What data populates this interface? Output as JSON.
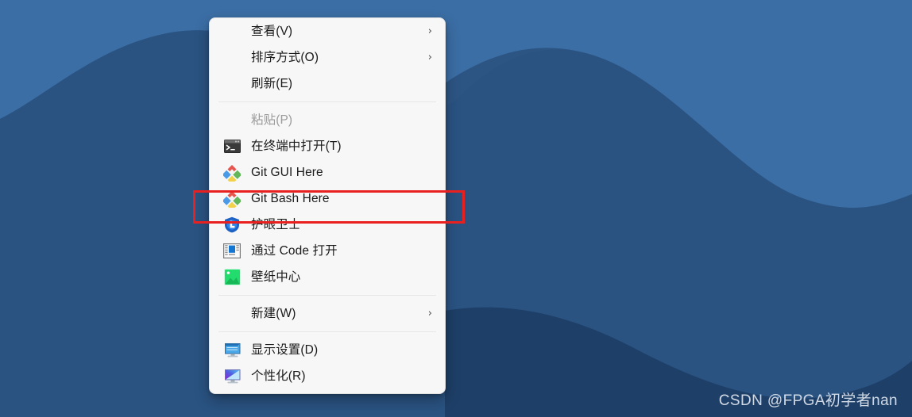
{
  "desktop": {
    "wallpaper_name": "blue-layered-waves-wallpaper",
    "colors": {
      "sky": "#3b6ea5",
      "hill_back": "#2d5584",
      "mid": "#2b5a8c",
      "front": "#1e3f68",
      "base": "#274d78"
    },
    "watermark": "CSDN @FPGA初学者nan"
  },
  "context_menu": {
    "groups": [
      {
        "items": [
          {
            "label": "查看(V)",
            "icon": "none",
            "submenu": true,
            "disabled": false,
            "chevron": "›"
          },
          {
            "label": "排序方式(O)",
            "icon": "none",
            "submenu": true,
            "disabled": false,
            "chevron": "›"
          },
          {
            "label": "刷新(E)",
            "icon": "none",
            "submenu": false,
            "disabled": false,
            "chevron": ""
          }
        ]
      },
      {
        "items": [
          {
            "label": "粘贴(P)",
            "icon": "none",
            "submenu": false,
            "disabled": true,
            "chevron": ""
          },
          {
            "label": "在终端中打开(T)",
            "icon": "terminal-icon",
            "submenu": false,
            "disabled": false,
            "chevron": ""
          },
          {
            "label": "Git GUI Here",
            "icon": "git-icon",
            "submenu": false,
            "disabled": false,
            "chevron": ""
          },
          {
            "label": "Git Bash Here",
            "icon": "git-icon",
            "submenu": false,
            "disabled": false,
            "chevron": "",
            "highlighted": true
          },
          {
            "label": "护眼卫士",
            "icon": "eye-guard-icon",
            "submenu": false,
            "disabled": false,
            "chevron": ""
          },
          {
            "label": "通过 Code 打开",
            "icon": "vscode-window-icon",
            "submenu": false,
            "disabled": false,
            "chevron": ""
          },
          {
            "label": "壁纸中心",
            "icon": "wallpaper-center-icon",
            "submenu": false,
            "disabled": false,
            "chevron": ""
          }
        ]
      },
      {
        "items": [
          {
            "label": "新建(W)",
            "icon": "none",
            "submenu": true,
            "disabled": false,
            "chevron": "›"
          }
        ]
      },
      {
        "items": [
          {
            "label": "显示设置(D)",
            "icon": "display-settings-icon",
            "submenu": false,
            "disabled": false,
            "chevron": ""
          },
          {
            "label": "个性化(R)",
            "icon": "personalize-icon",
            "submenu": false,
            "disabled": false,
            "chevron": ""
          }
        ]
      }
    ]
  },
  "annotation": {
    "highlight_target": "Git Bash Here",
    "color": "#e8201f"
  }
}
